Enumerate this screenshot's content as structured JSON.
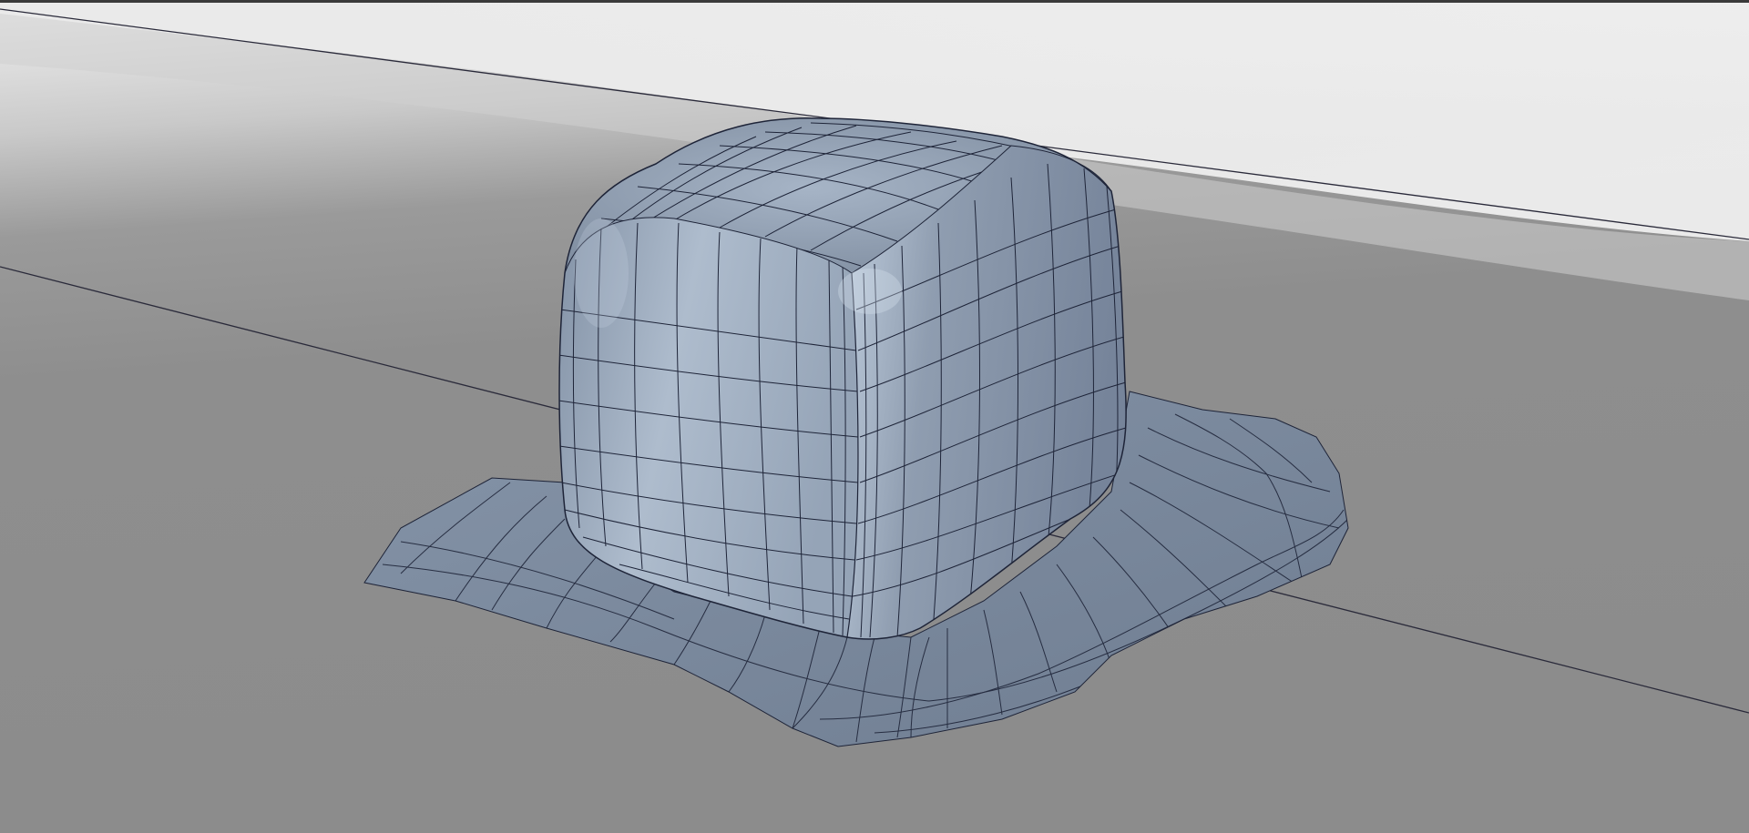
{
  "viewport": {
    "shading_mode": "smooth-shaded-wireframe-on-shaded",
    "background_colors": {
      "floor": "#8e8e8e",
      "horizon_band": "#d9d9d9",
      "sky": "#ededed"
    },
    "mesh_color": "#8d9cb0",
    "mesh_highlight": "#c2d0e0",
    "mesh_shadow": "#5d6878",
    "wire_color": "#1e2438",
    "grid_axis_color": "#2a2a3a"
  },
  "scene_objects": [
    {
      "name": "deformed-cube-mesh",
      "type": "polygon-mesh"
    },
    {
      "name": "ground-plane-mesh",
      "type": "polygon-mesh"
    }
  ]
}
